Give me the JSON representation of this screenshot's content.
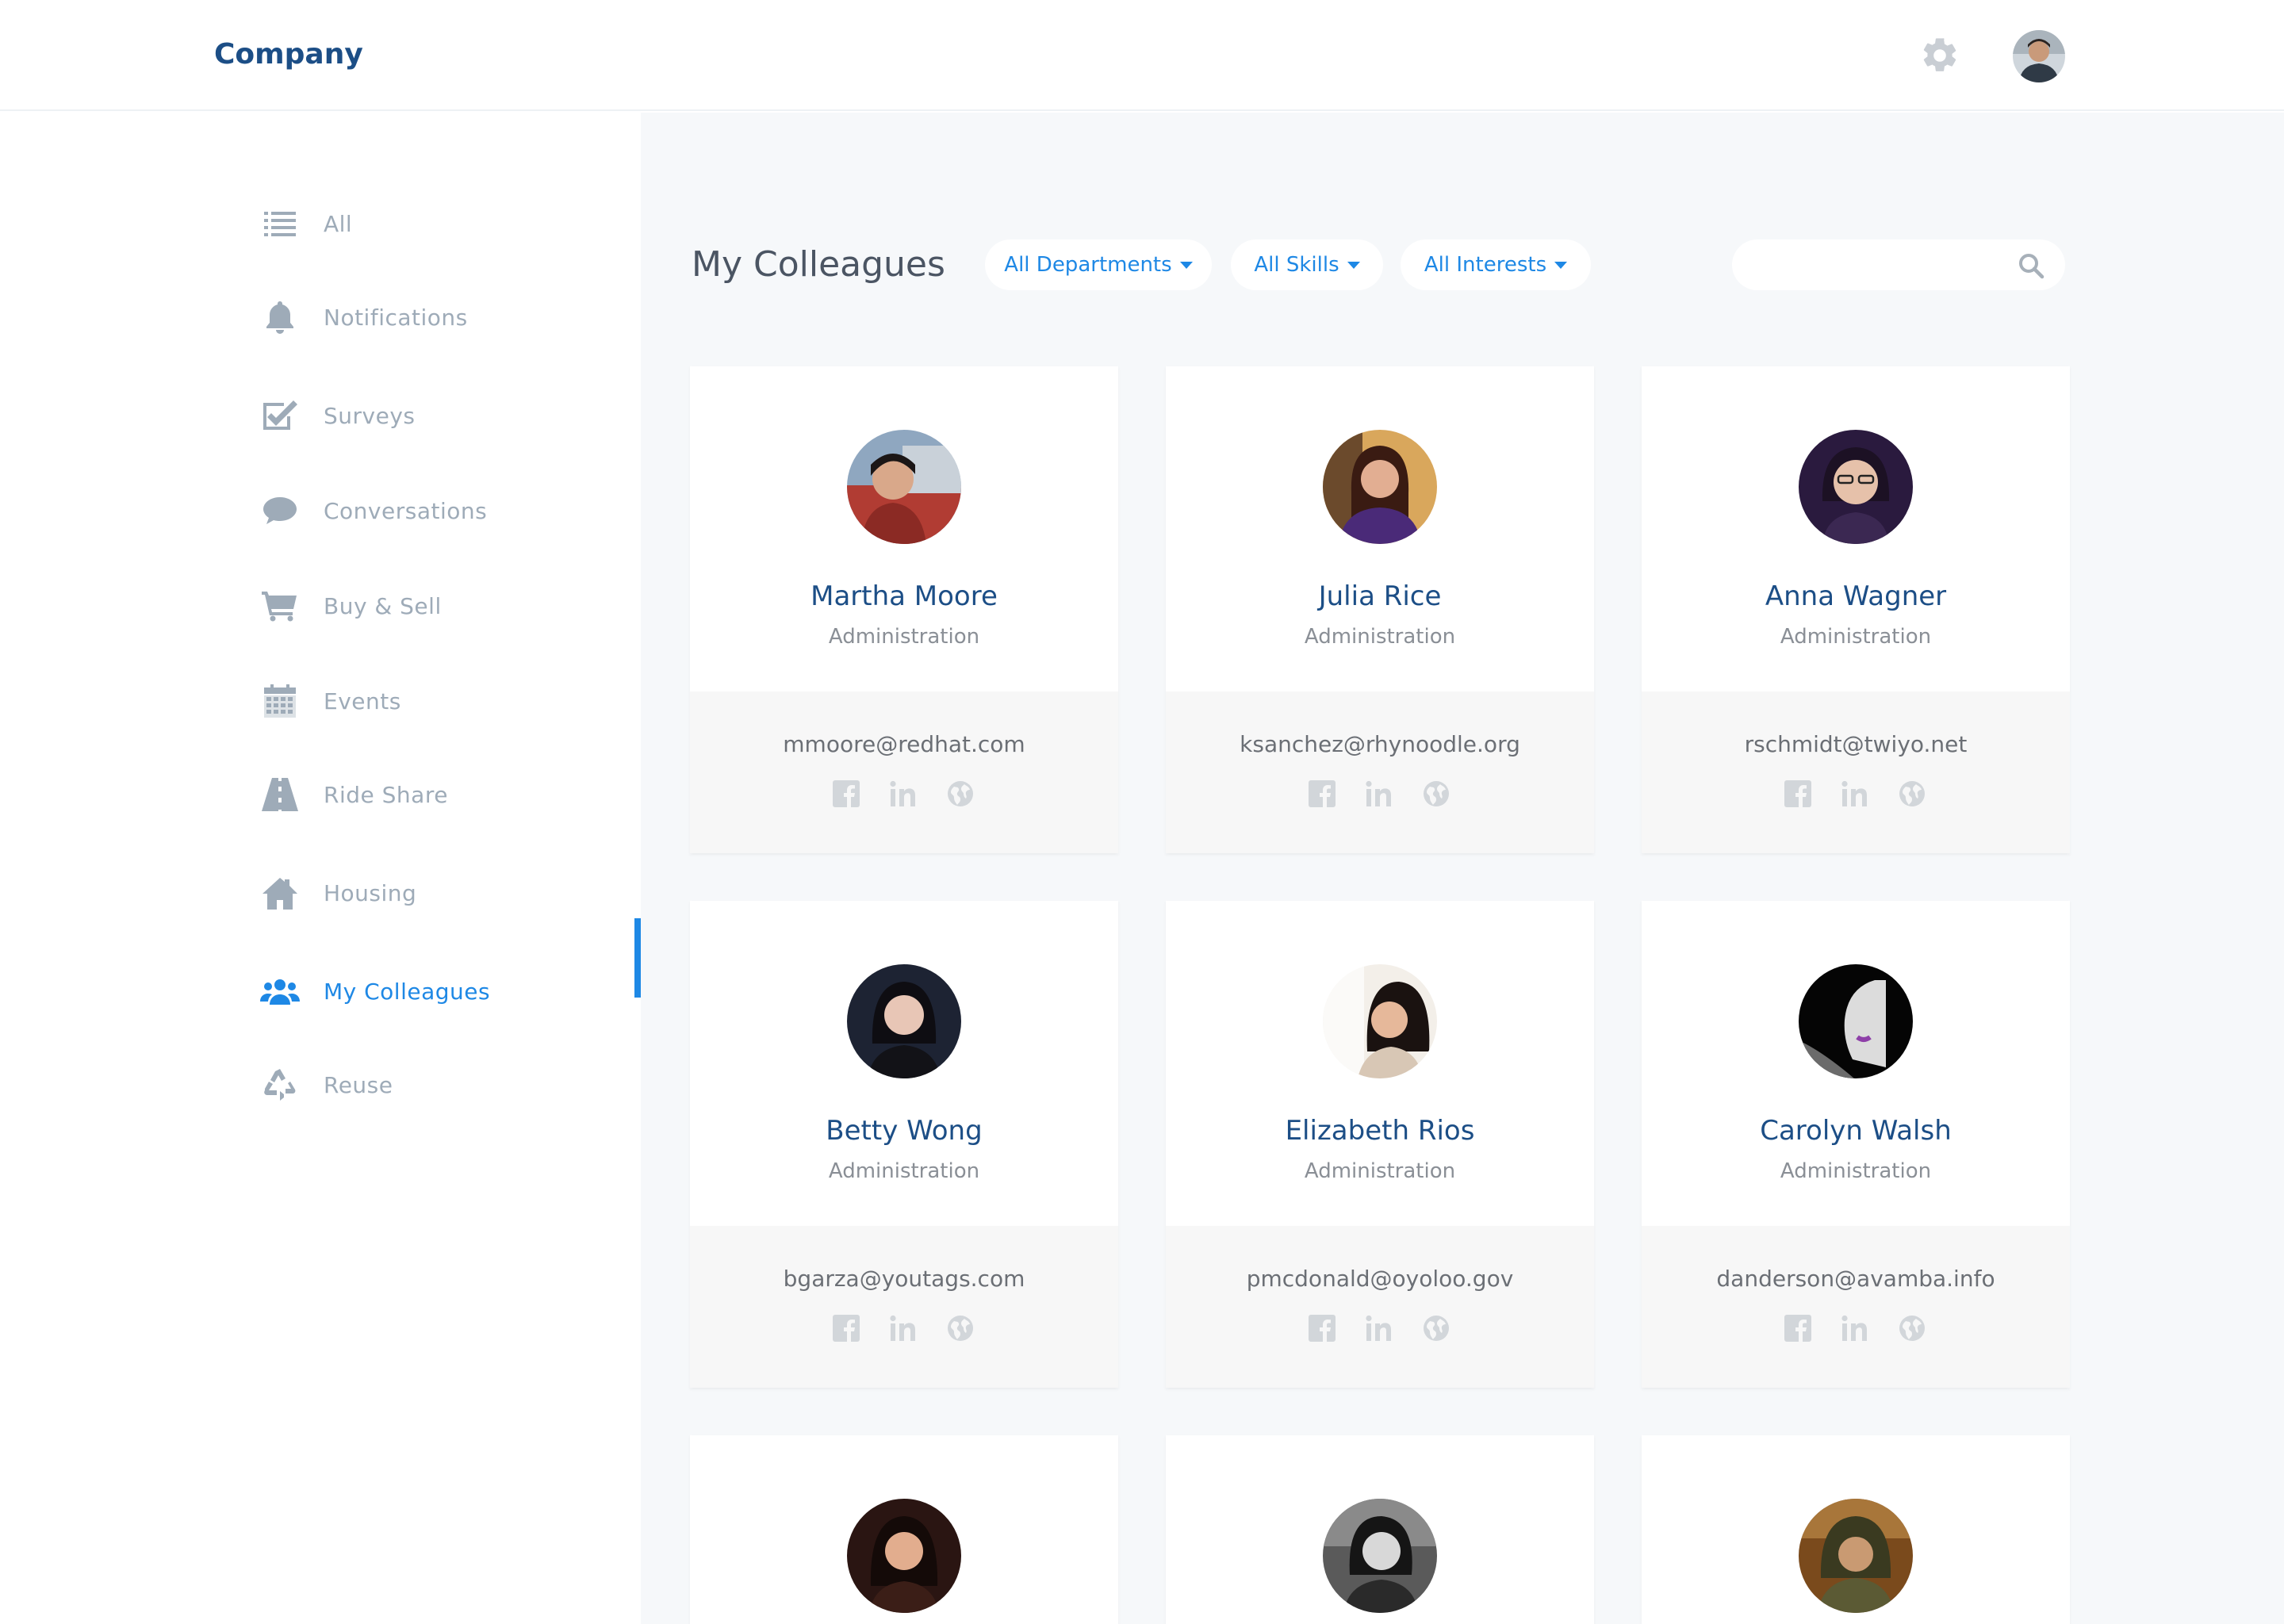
{
  "header": {
    "brand": "Company"
  },
  "sidebar": {
    "items": [
      {
        "label": "All",
        "icon": "list-icon",
        "active": false
      },
      {
        "label": "Notifications",
        "icon": "bell-icon",
        "active": false
      },
      {
        "label": "Surveys",
        "icon": "checkbox-icon",
        "active": false
      },
      {
        "label": "Conversations",
        "icon": "chat-bubble-icon",
        "active": false
      },
      {
        "label": "Buy & Sell",
        "icon": "cart-icon",
        "active": false
      },
      {
        "label": "Events",
        "icon": "calendar-icon",
        "active": false
      },
      {
        "label": "Ride Share",
        "icon": "road-icon",
        "active": false
      },
      {
        "label": "Housing",
        "icon": "house-icon",
        "active": false
      },
      {
        "label": "My Colleagues",
        "icon": "people-icon",
        "active": true
      },
      {
        "label": "Reuse",
        "icon": "recycle-icon",
        "active": false
      }
    ]
  },
  "main": {
    "title": "My Colleagues",
    "filters": [
      {
        "label": "All Departments"
      },
      {
        "label": "All Skills"
      },
      {
        "label": "All Interests"
      }
    ],
    "search": {
      "value": "",
      "placeholder": ""
    }
  },
  "colleagues": [
    {
      "name": "Martha Moore",
      "department": "Administration",
      "email": "mmoore@redhat.com"
    },
    {
      "name": "Julia Rice",
      "department": "Administration",
      "email": "ksanchez@rhynoodle.org"
    },
    {
      "name": "Anna Wagner",
      "department": "Administration",
      "email": "rschmidt@twiyo.net"
    },
    {
      "name": "Betty Wong",
      "department": "Administration",
      "email": "bgarza@youtags.com"
    },
    {
      "name": "Elizabeth Rios",
      "department": "Administration",
      "email": "pmcdonald@oyoloo.gov"
    },
    {
      "name": "Carolyn Walsh",
      "department": "Administration",
      "email": "danderson@avamba.info"
    },
    {
      "name": "",
      "department": "",
      "email": ""
    },
    {
      "name": "",
      "department": "",
      "email": ""
    },
    {
      "name": "",
      "department": "",
      "email": ""
    }
  ],
  "colors": {
    "accent": "#1e88e5",
    "brand": "#1c4e86",
    "nav_text": "#9eabb8",
    "background": "#f6f8fa"
  }
}
